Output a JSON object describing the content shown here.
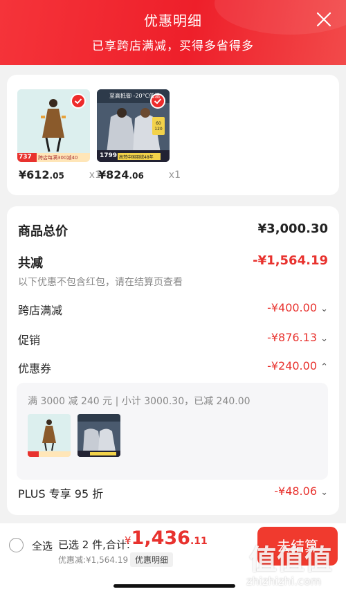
{
  "header": {
    "title": "优惠明细",
    "subtitle": "已享跨店满减，买得多省得多"
  },
  "products": [
    {
      "price_int": "¥612",
      "price_dec": ".05",
      "qty": "x1",
      "tag_price": "737",
      "tag_text": "跨店每满300减40"
    },
    {
      "price_int": "¥824",
      "price_dec": ".06",
      "qty": "x1",
      "tag_price": "1799",
      "banner": "至高抵御 -20°C低温",
      "badge": "60 120",
      "promo": "高梵中国羽绒48年"
    }
  ],
  "summary": {
    "total_label": "商品总价",
    "total_value": "¥3,000.30",
    "discount_label": "共减",
    "discount_value": "-¥1,564.19",
    "note": "以下优惠不包含红包，请在结算页查看",
    "items": [
      {
        "label": "跨店满减",
        "value": "-¥400.00",
        "chevron": "⌄"
      },
      {
        "label": "促销",
        "value": "-¥876.13",
        "chevron": "⌄"
      },
      {
        "label": "优惠券",
        "value": "-¥240.00",
        "chevron": "⌃"
      }
    ],
    "coupon_detail": "满 3000 减 240 元 | 小计 3000.30，已减 240.00",
    "plus_label": "PLUS 专享 95 折",
    "plus_value": "-¥48.06",
    "plus_chevron": "⌄"
  },
  "bottom_bar": {
    "select_all": "全选",
    "selected_text": "已选 2 件,合计:",
    "total_symbol": "¥",
    "total_int": "1,436",
    "total_dec": ".11",
    "discount_text": "优惠减:¥1,564.19",
    "detail_button": "优惠明细",
    "checkout_label": "去结算"
  },
  "watermark": {
    "logo_text": "值",
    "url": "zhizhizhi.com"
  },
  "colors": {
    "brand_red": "#ee1f2a",
    "discount_red": "#e8322e",
    "muted": "#999999"
  }
}
